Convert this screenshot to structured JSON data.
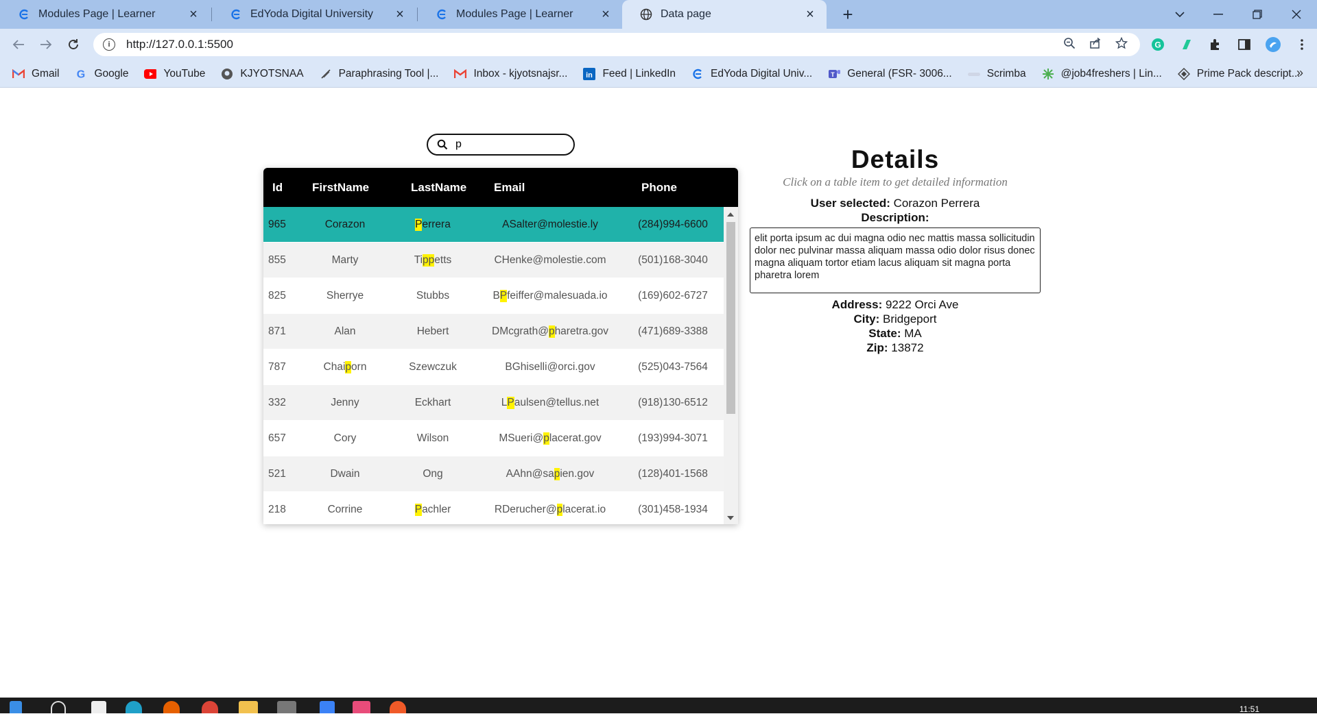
{
  "browser": {
    "tabs": [
      {
        "title": "Modules Page | Learner",
        "icon": "edyoda-icon",
        "active": false
      },
      {
        "title": "EdYoda Digital University",
        "icon": "edyoda-icon",
        "active": false
      },
      {
        "title": "Modules Page | Learner",
        "icon": "edyoda-icon",
        "active": false
      },
      {
        "title": "Data page",
        "icon": "globe-icon",
        "active": true
      }
    ],
    "url": "http://127.0.0.1:5500",
    "bookmarks": [
      {
        "label": "Gmail",
        "icon": "gmail-icon"
      },
      {
        "label": "Google",
        "icon": "google-icon"
      },
      {
        "label": "YouTube",
        "icon": "youtube-icon"
      },
      {
        "label": "KJYOTSNAA",
        "icon": "github-icon"
      },
      {
        "label": "Paraphrasing Tool |...",
        "icon": "quill-icon"
      },
      {
        "label": "Inbox - kjyotsnajsr...",
        "icon": "gmail-icon"
      },
      {
        "label": "Feed | LinkedIn",
        "icon": "linkedin-icon"
      },
      {
        "label": "EdYoda Digital Univ...",
        "icon": "edyoda-icon"
      },
      {
        "label": "General (FSR- 3006...",
        "icon": "teams-icon"
      },
      {
        "label": "Scrimba",
        "icon": "scrimba-icon"
      },
      {
        "label": "@job4freshers | Lin...",
        "icon": "job4freshers-icon"
      },
      {
        "label": "Prime Pack descript...",
        "icon": "primepack-icon"
      }
    ],
    "colors": {
      "tabstrip": "#a6c3ea",
      "toolbar": "#dbe7f8"
    }
  },
  "search": {
    "value": "p",
    "placeholder": ""
  },
  "table": {
    "headers": [
      "Id",
      "FirstName",
      "LastName",
      "Email",
      "Phone"
    ],
    "rows": [
      {
        "id": "965",
        "first": "Corazon",
        "last": "Perrera",
        "email": "ASalter@molestie.ly",
        "phone": "(284)994-6600",
        "selected": true
      },
      {
        "id": "855",
        "first": "Marty",
        "last": "Tippetts",
        "email": "CHenke@molestie.com",
        "phone": "(501)168-3040"
      },
      {
        "id": "825",
        "first": "Sherrye",
        "last": "Stubbs",
        "email": "BPfeiffer@malesuada.io",
        "phone": "(169)602-6727"
      },
      {
        "id": "871",
        "first": "Alan",
        "last": "Hebert",
        "email": "DMcgrath@pharetra.gov",
        "phone": "(471)689-3388"
      },
      {
        "id": "787",
        "first": "Chaiporn",
        "last": "Szewczuk",
        "email": "BGhiselli@orci.gov",
        "phone": "(525)043-7564"
      },
      {
        "id": "332",
        "first": "Jenny",
        "last": "Eckhart",
        "email": "LPaulsen@tellus.net",
        "phone": "(918)130-6512"
      },
      {
        "id": "657",
        "first": "Cory",
        "last": "Wilson",
        "email": "MSueri@placerat.gov",
        "phone": "(193)994-3071"
      },
      {
        "id": "521",
        "first": "Dwain",
        "last": "Ong",
        "email": "AAhn@sapien.gov",
        "phone": "(128)401-1568"
      },
      {
        "id": "218",
        "first": "Corrine",
        "last": "Pachler",
        "email": "RDerucher@placerat.io",
        "phone": "(301)458-1934"
      }
    ],
    "colors": {
      "header_bg": "#000000",
      "selected_row": "#20b2aa",
      "highlight": "#fff200"
    }
  },
  "details": {
    "title": "Details",
    "subtitle": "Click on a table item to get detailed information",
    "user_label": "User selected:",
    "user_value": "Corazon Perrera",
    "description_label": "Description:",
    "description": "elit porta ipsum ac dui magna odio nec mattis massa sollicitudin dolor nec pulvinar massa aliquam massa odio dolor risus donec magna aliquam tortor etiam lacus aliquam sit magna porta pharetra lorem",
    "address_label": "Address:",
    "address_value": "9222 Orci Ave",
    "city_label": "City:",
    "city_value": "Bridgeport",
    "state_label": "State:",
    "state_value": "MA",
    "zip_label": "Zip:",
    "zip_value": "13872"
  },
  "taskbar": {
    "clock": "11:51"
  }
}
